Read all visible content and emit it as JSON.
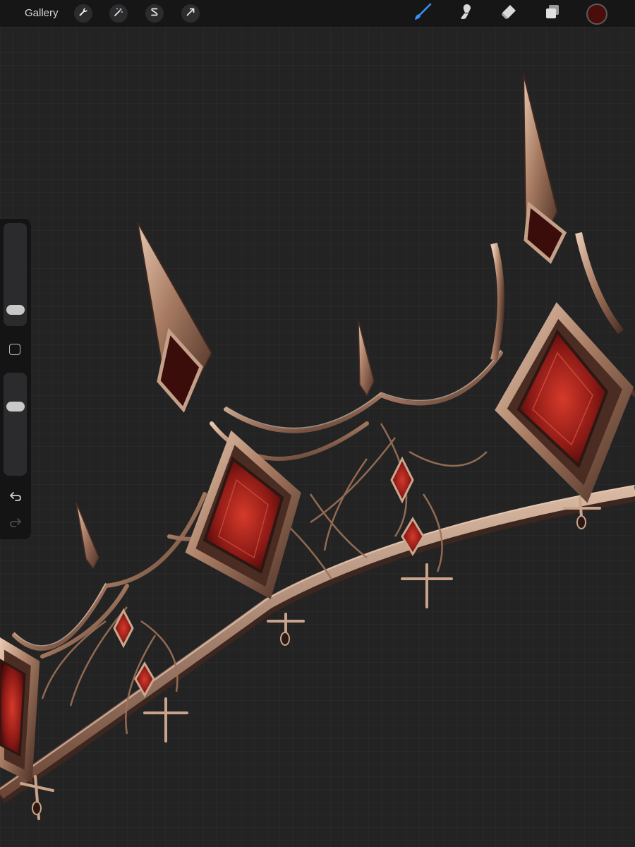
{
  "app": {
    "gallery_label": "Gallery"
  },
  "toolbar": {
    "actions": [
      {
        "name": "actions-wrench",
        "icon": "wrench-icon"
      },
      {
        "name": "adjustments",
        "icon": "magic-wand-icon"
      },
      {
        "name": "selection",
        "icon": "selection-s-icon"
      },
      {
        "name": "transform",
        "icon": "transform-arrow-icon"
      }
    ],
    "tools": [
      {
        "name": "brush",
        "icon": "brush-icon",
        "active": true
      },
      {
        "name": "smudge",
        "icon": "smudge-icon",
        "active": false
      },
      {
        "name": "eraser",
        "icon": "eraser-icon",
        "active": false
      },
      {
        "name": "layers",
        "icon": "layers-icon",
        "active": false
      }
    ],
    "current_color": "#4a0d0c",
    "active_tool_color": "#3a8ff5"
  },
  "sidebar": {
    "brush_size_level": 0.1,
    "brush_opacity_level": 0.7,
    "modify_button_icon": "square-icon",
    "undo_icon": "undo-icon",
    "redo_icon": "redo-icon",
    "redo_enabled": false
  },
  "colors": {
    "canvas_bg": "#232324",
    "toolbar_bg": "#161617",
    "metal_light": "#c9a48a",
    "metal_dark": "#5a3a2c",
    "gem_red": "#8e1a16"
  }
}
